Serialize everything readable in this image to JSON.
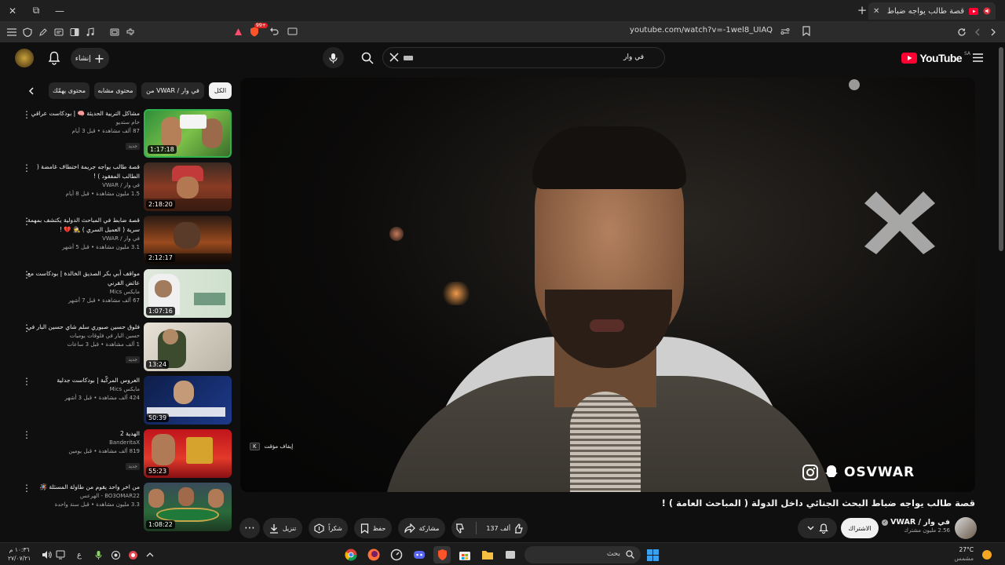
{
  "browser": {
    "tab_title": "قصة طالب يواجه ضباط البحث ال",
    "url": "youtube.com/watch?v=-1wel8_UIAQ",
    "shield_count": "99+"
  },
  "header": {
    "logo_label": "YouTube",
    "logo_region": "SA",
    "search_value": "في وار",
    "create_label": "إنشاء"
  },
  "chips": {
    "all": "الكل",
    "from_channel": "من VWAR / في وار",
    "related": "محتوى مشابه",
    "for_you": "محتوى يهمّك"
  },
  "recommendations": [
    {
      "title": "مشاكل التربية الحديثة 🧠 | بودكاست عراقي",
      "channel": "حام ستديو",
      "meta": "87 ألف مشاهدة • قبل 3 أيام",
      "badge": "جديد",
      "duration": "1:17:18"
    },
    {
      "title": "قصة طالب يواجه جريمة اختطاف غامضة ( الطالب المفقود ) !",
      "channel": "في وار / VWAR",
      "meta": "1.5 مليون مشاهدة • قبل 8 أيام",
      "badge": "",
      "duration": "2:18:20"
    },
    {
      "title": "قصة ضابط في المباحث الدولية يكتشف بمهمة سرية ( العميل السري ) 🕵️ 💔 !",
      "channel": "في وار / VWAR",
      "meta": "3.1 مليون مشاهدة • قبل 5 أشهر",
      "badge": "",
      "duration": "2:12:17"
    },
    {
      "title": "مواقف أبي بكر الصديق الخالدة | بودكاست مع عائض القرني",
      "channel": "مايكس Mics",
      "meta": "67 ألف مشاهدة • قبل 7 أشهر",
      "badge": "",
      "duration": "1:07:16"
    },
    {
      "title": "فلوق حسين صبوري سلم شاي حسين البار في",
      "channel": "حسين البار في فلوقات يوميات",
      "meta": "1 ألف مشاهدة • قبل 3 ساعات",
      "badge": "جديد",
      "duration": "13:24"
    },
    {
      "title": "العروس المركّبة | بودكاست جدلية",
      "channel": "مايكس Mics",
      "meta": "424 ألف مشاهدة • قبل 3 أشهر",
      "badge": "",
      "duration": "50:39"
    },
    {
      "title": "الهدية 2",
      "channel": "BanderitaX",
      "meta": "819 ألف مشاهدة • قبل يومين",
      "badge": "جديد",
      "duration": "55:23"
    },
    {
      "title": "من اخر واحد يقوم من طاولة المسئلة 🪅",
      "channel": "BO3OMAR22 - الهرعس",
      "meta": "3.3 مليون مشاهدة • قبل سنة واحدة",
      "badge": "",
      "duration": "1:08:22"
    }
  ],
  "video": {
    "title": "قصة طالب يواجه ضباط البحث الجنائي داخل الدولة ( المباحث العامة ) !",
    "watermark": "OSVWAR",
    "tooltip_key": "K",
    "tooltip_text": "إيقاف مؤقت"
  },
  "channel": {
    "name": "في وار / VWAR",
    "subscribers": "2.56 مليون مشترك",
    "subscribe_label": "الاشتراك"
  },
  "actions": {
    "likes": "137 ألف",
    "share": "مشاركة",
    "save": "حفظ",
    "thanks": "شكراً",
    "download": "تنزيل"
  },
  "taskbar": {
    "search_placeholder": "بحث",
    "temperature": "27°C",
    "weather": "مشمس",
    "time": "١٠:٣٦ م",
    "date": "٢٧/٠٧/٢١",
    "lang": "ع"
  },
  "colors": {
    "yt_red": "#ff0033",
    "subscribe_bg": "#f1f1f1",
    "chip_bg": "#272727"
  }
}
